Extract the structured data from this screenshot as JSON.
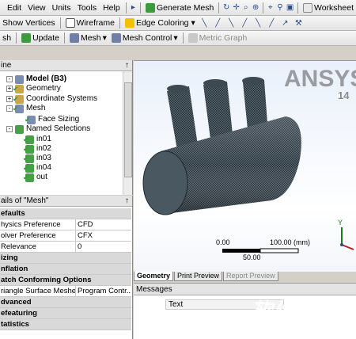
{
  "menubar": {
    "items": [
      "Edit",
      "View",
      "Units",
      "Tools",
      "Help"
    ],
    "generate_mesh": "Generate Mesh",
    "worksheet": "Worksheet"
  },
  "toolbar2": {
    "show_vertices": "Show Vertices",
    "wireframe": "Wireframe",
    "edge_coloring": "Edge Coloring"
  },
  "toolbar3": {
    "mesh_label": "sh",
    "update": "Update",
    "mesh": "Mesh",
    "mesh_control": "Mesh Control",
    "metric_graph": "Metric Graph"
  },
  "outline": {
    "title": "ine",
    "pin": "↑",
    "tree": [
      {
        "label": "Model (B3)",
        "bold": true
      },
      {
        "label": "Geometry"
      },
      {
        "label": "Coordinate Systems"
      },
      {
        "label": "Mesh"
      },
      {
        "label": "Face Sizing"
      },
      {
        "label": "Named Selections"
      },
      {
        "label": "in01"
      },
      {
        "label": "in02"
      },
      {
        "label": "in03"
      },
      {
        "label": "in04"
      },
      {
        "label": "out"
      }
    ]
  },
  "details": {
    "title": "ails of \"Mesh\"",
    "pin": "↑",
    "rows": [
      {
        "type": "header",
        "label": "efaults"
      },
      {
        "type": "prop",
        "key": "hysics Preference",
        "value": "CFD"
      },
      {
        "type": "prop",
        "key": "olver Preference",
        "value": "CFX"
      },
      {
        "type": "prop",
        "key": "  Relevance",
        "value": "0"
      },
      {
        "type": "header",
        "label": "izing"
      },
      {
        "type": "header",
        "label": "nflation"
      },
      {
        "type": "header",
        "label": "atch Conforming Options"
      },
      {
        "type": "prop",
        "key": "riangle Surface Mesher",
        "value": "Program Contr..."
      },
      {
        "type": "header",
        "label": "dvanced"
      },
      {
        "type": "header",
        "label": "efeaturing"
      },
      {
        "type": "header",
        "label": "tatistics"
      }
    ]
  },
  "viewport": {
    "logo": "ANSYS",
    "version": "14",
    "scale_start": "0.00",
    "scale_end": "100.00 (mm)",
    "scale_mid": "50.00",
    "axis_label": "Y"
  },
  "tabs": [
    "Geometry",
    "Print Preview",
    "Report Preview"
  ],
  "messages": {
    "title": "Messages",
    "column": "Text"
  },
  "watermark": "软件技巧",
  "colors": {
    "accent": "#2a4e8a",
    "mesh_fill": "#4a5a66",
    "check": "#2f9a2f"
  }
}
